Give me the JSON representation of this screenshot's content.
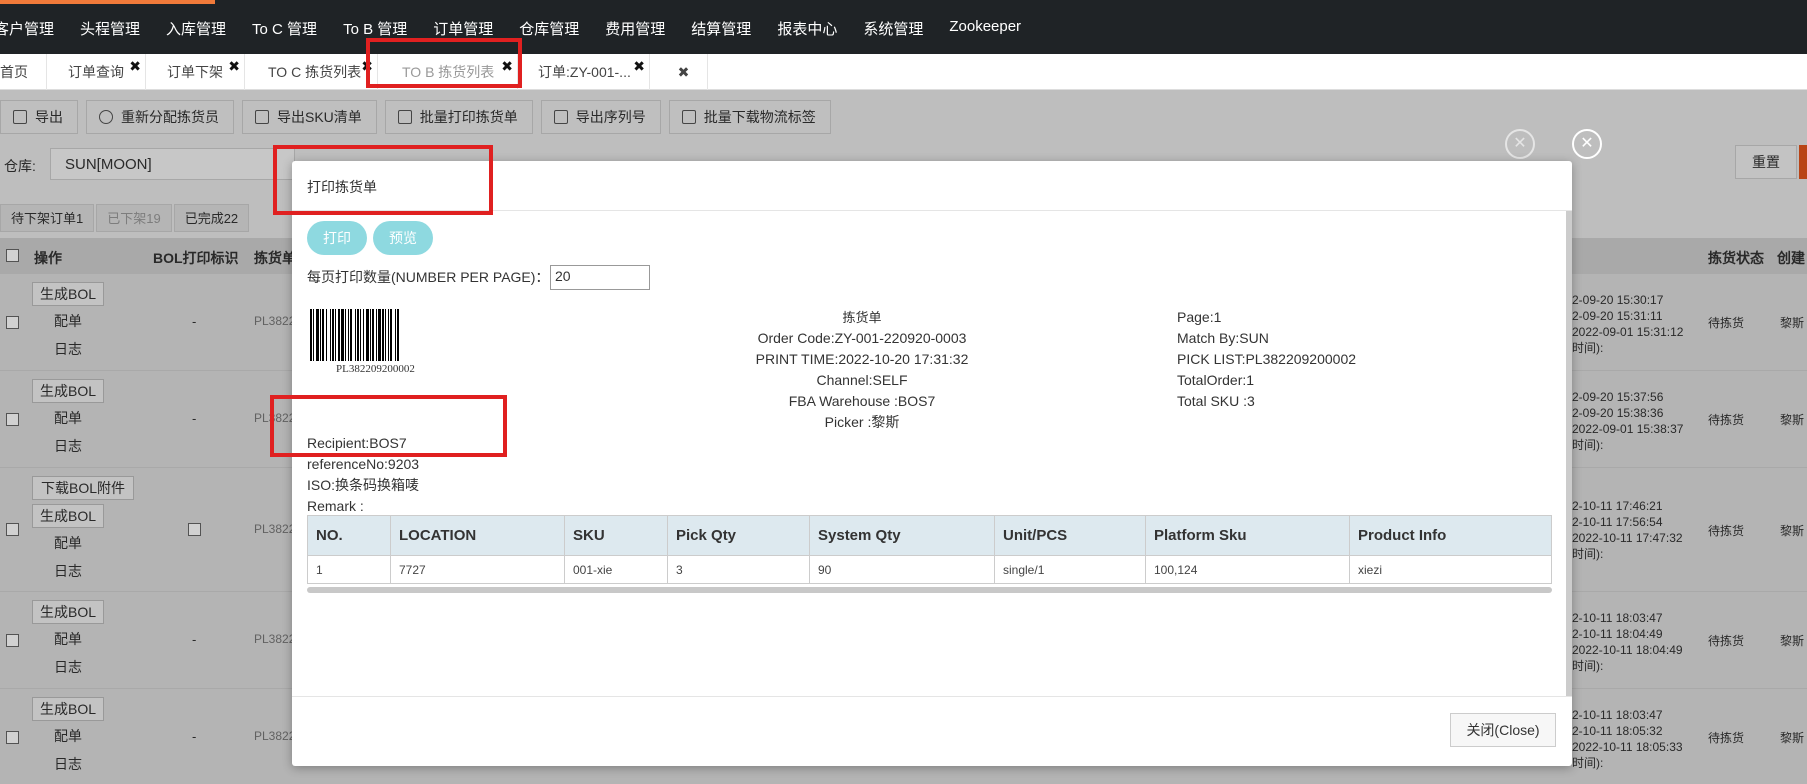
{
  "nav": {
    "items": [
      "客户管理",
      "头程管理",
      "入库管理",
      "To C 管理",
      "To B 管理",
      "订单管理",
      "仓库管理",
      "费用管理",
      "结算管理",
      "报表中心",
      "系统管理",
      "Zookeeper"
    ]
  },
  "tabs": [
    {
      "label": "首页"
    },
    {
      "label": "订单查询"
    },
    {
      "label": "订单下架"
    },
    {
      "label": "TO C 拣货列表"
    },
    {
      "label": "TO B 拣货列表"
    },
    {
      "label": "订单:ZY-001-..."
    }
  ],
  "toolbar": {
    "buttons": [
      "导出",
      "重新分配拣货员",
      "导出SKU清单",
      "批量打印拣货单",
      "导出序列号",
      "批量下载物流标签"
    ]
  },
  "filter": {
    "warehouse_label": "仓库:",
    "warehouse_value": "SUN[MOON]",
    "reset_label": "重置"
  },
  "subtabs": [
    "待下架订单1",
    "已下架19",
    "已完成22"
  ],
  "bg_table": {
    "headers": {
      "op": "操作",
      "bol_flag": "BOL打印标识",
      "pick_no": "拣货单",
      "status": "拣货状态",
      "creator": "创建"
    },
    "rows": [
      {
        "ops": [
          "生成BOL",
          "配单",
          "日志"
        ],
        "flag": "-",
        "pick": "PL3822",
        "times": [
          "2-09-20 15:30:17",
          "2-09-20 15:31:11",
          "2022-09-01 15:31:12",
          "时间):"
        ],
        "status": "待拣货",
        "creator": "黎斯"
      },
      {
        "ops": [
          "生成BOL",
          "配单",
          "日志"
        ],
        "flag": "-",
        "pick": "PL3822",
        "times": [
          "2-09-20 15:37:56",
          "2-09-20 15:38:36",
          "2022-09-01 15:38:37",
          "时间):"
        ],
        "status": "待拣货",
        "creator": "黎斯"
      },
      {
        "ops": [
          "下载BOL附件",
          "生成BOL",
          "配单",
          "日志"
        ],
        "flag": "",
        "pick": "PL3822",
        "times": [
          "2-10-11 17:46:21",
          "2-10-11 17:56:54",
          "2022-10-11 17:47:32",
          "时间):"
        ],
        "status": "待拣货",
        "creator": "黎斯"
      },
      {
        "ops": [
          "生成BOL",
          "配单",
          "日志"
        ],
        "flag": "-",
        "pick": "PL3822",
        "times": [
          "2-10-11 18:03:47",
          "2-10-11 18:04:49",
          "2022-10-11 18:04:49",
          "时间):"
        ],
        "status": "待拣货",
        "creator": "黎斯"
      },
      {
        "ops": [
          "生成BOL",
          "配单",
          "日志"
        ],
        "flag": "-",
        "pick": "PL3822",
        "times": [
          "2-10-11 18:03:47",
          "2-10-11 18:05:32",
          "2022-10-11 18:05:33",
          "时间):"
        ],
        "status": "待拣货",
        "creator": "黎斯"
      }
    ]
  },
  "modal": {
    "title": "打印拣货单",
    "print_label": "打印",
    "preview_label": "预览",
    "npp_label": "每页打印数量(NUMBER PER PAGE)：",
    "npp_value": "20",
    "barcode_text": "PL382209200002",
    "center": {
      "title": "拣货单",
      "order_code": "Order Code:ZY-001-220920-0003",
      "print_time": "PRINT TIME:2022-10-20 17:31:32",
      "channel": "Channel:SELF",
      "fba": "FBA Warehouse :BOS7",
      "picker": "Picker :黎斯"
    },
    "right": {
      "page": "Page:1",
      "match_by": "Match By:SUN",
      "pick_list": "PICK LIST:PL382209200002",
      "total_order": "TotalOrder:1",
      "total_sku": "Total SKU :3"
    },
    "left": {
      "recipient": "Recipient:BOS7",
      "reference": "referenceNo:9203",
      "iso": "ISO:换条码换箱唛",
      "remark": "Remark :"
    },
    "table": {
      "headers": [
        "NO.",
        "LOCATION",
        "SKU",
        "Pick Qty",
        "System Qty",
        "Unit/PCS",
        "Platform Sku",
        "Product Info"
      ],
      "rows": [
        [
          "1",
          "7727",
          "001-xie",
          "3",
          "90",
          "single/1",
          "100,124",
          "xiezi"
        ]
      ]
    },
    "close_label": "关闭(Close)"
  }
}
